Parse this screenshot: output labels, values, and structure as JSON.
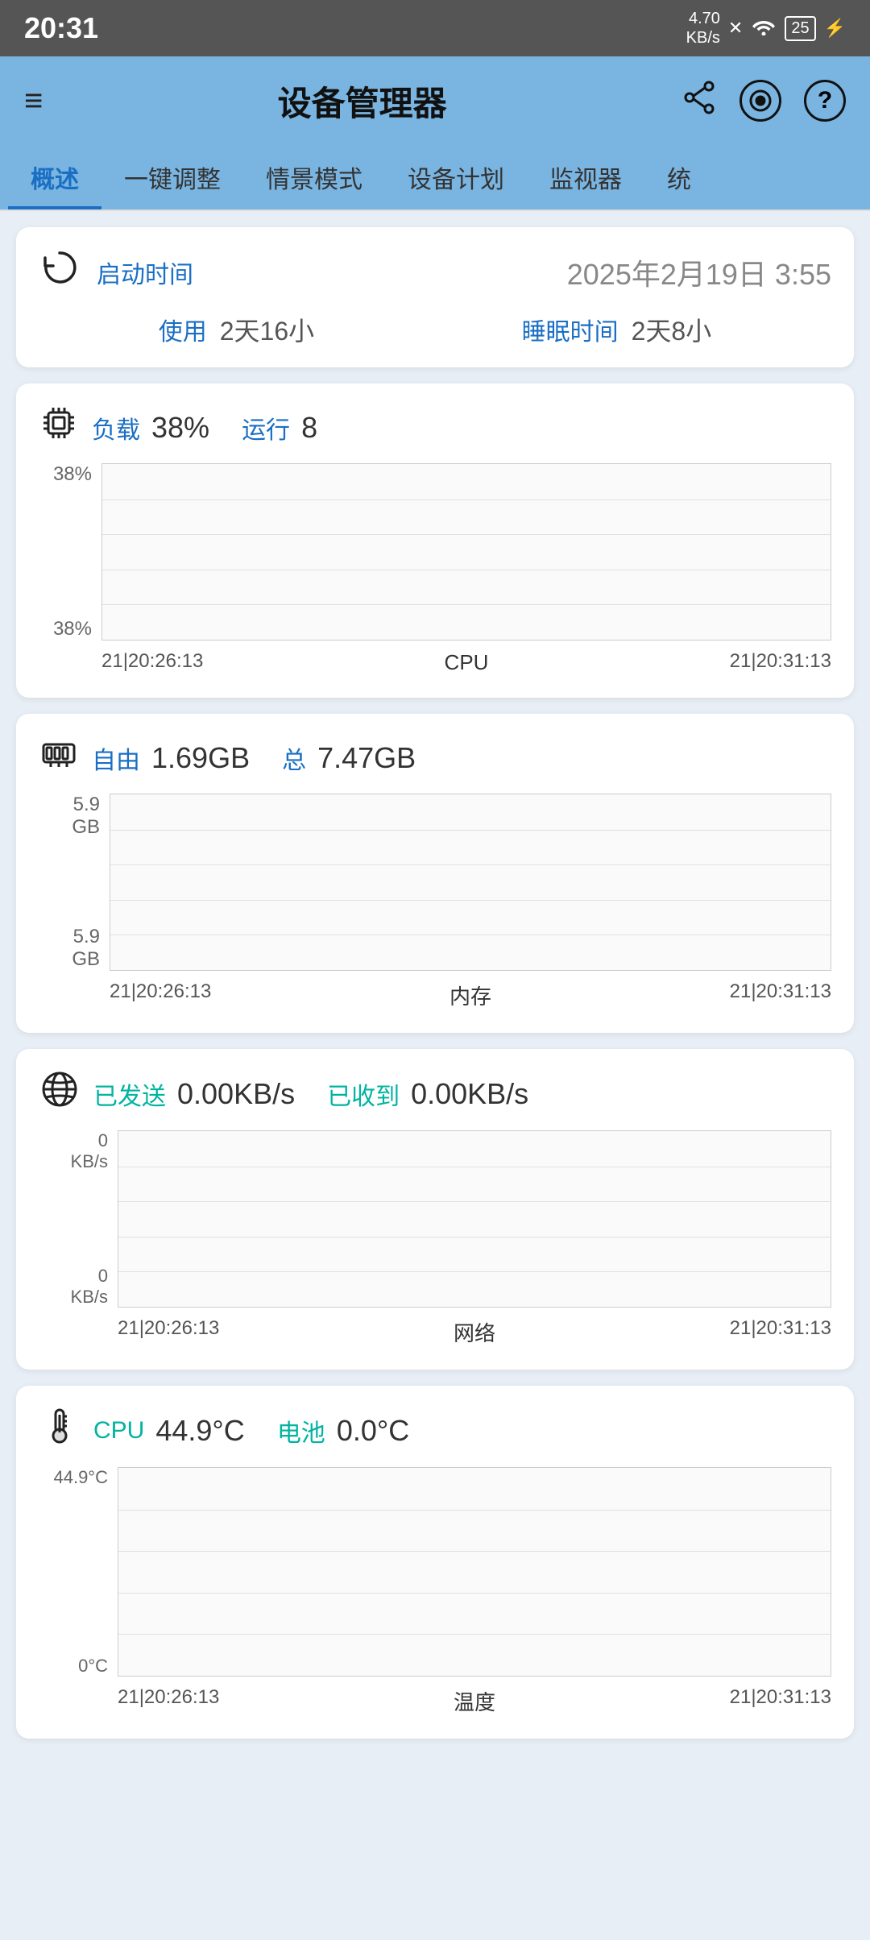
{
  "statusBar": {
    "time": "20:31",
    "network": "4.70\nKB/s",
    "batteryLevel": "25"
  },
  "appBar": {
    "title": "设备管理器",
    "menuIcon": "≡",
    "shareIcon": "⎘",
    "recordIcon": "⊙",
    "helpIcon": "?"
  },
  "tabs": [
    {
      "label": "概述",
      "active": true
    },
    {
      "label": "一键调整",
      "active": false
    },
    {
      "label": "情景模式",
      "active": false
    },
    {
      "label": "设备计划",
      "active": false
    },
    {
      "label": "监视器",
      "active": false
    },
    {
      "label": "统",
      "active": false
    }
  ],
  "bootCard": {
    "icon": "↺",
    "label": "启动时间",
    "time": "2025年2月19日 3:55",
    "usageLabel": "使用",
    "usageValue": "2天16小",
    "sleepLabel": "睡眠时间",
    "sleepValue": "2天8小"
  },
  "cpuCard": {
    "loadLabel": "负载",
    "loadValue": "38%",
    "runLabel": "运行",
    "runValue": "8",
    "chartYTop": "38%",
    "chartYBottom": "38%",
    "chartLabel": "CPU",
    "timeLeft": "21|20:26:13",
    "timeRight": "21|20:31:13"
  },
  "memCard": {
    "freeLabel": "自由",
    "freeValue": "1.69GB",
    "totalLabel": "总",
    "totalValue": "7.47GB",
    "chartYTop": "5.9\nGB",
    "chartYBottom": "5.9\nGB",
    "chartLabel": "内存",
    "timeLeft": "21|20:26:13",
    "timeRight": "21|20:31:13"
  },
  "networkCard": {
    "sentLabel": "已发送",
    "sentValue": "0.00KB/s",
    "recvLabel": "已收到",
    "recvValue": "0.00KB/s",
    "chartYTop": "0\nKB/s",
    "chartYBottom": "0\nKB/s",
    "chartLabel": "网络",
    "timeLeft": "21|20:26:13",
    "timeRight": "21|20:31:13"
  },
  "tempCard": {
    "cpuLabel": "CPU",
    "cpuTemp": "44.9°C",
    "batteryLabel": "电池",
    "batteryTemp": "0.0°C",
    "chartYTop": "44.9°C",
    "chartYBottom": "0°C",
    "chartLabel": "温度",
    "timeLeft": "21|20:26:13",
    "timeRight": "21|20:31:13"
  }
}
